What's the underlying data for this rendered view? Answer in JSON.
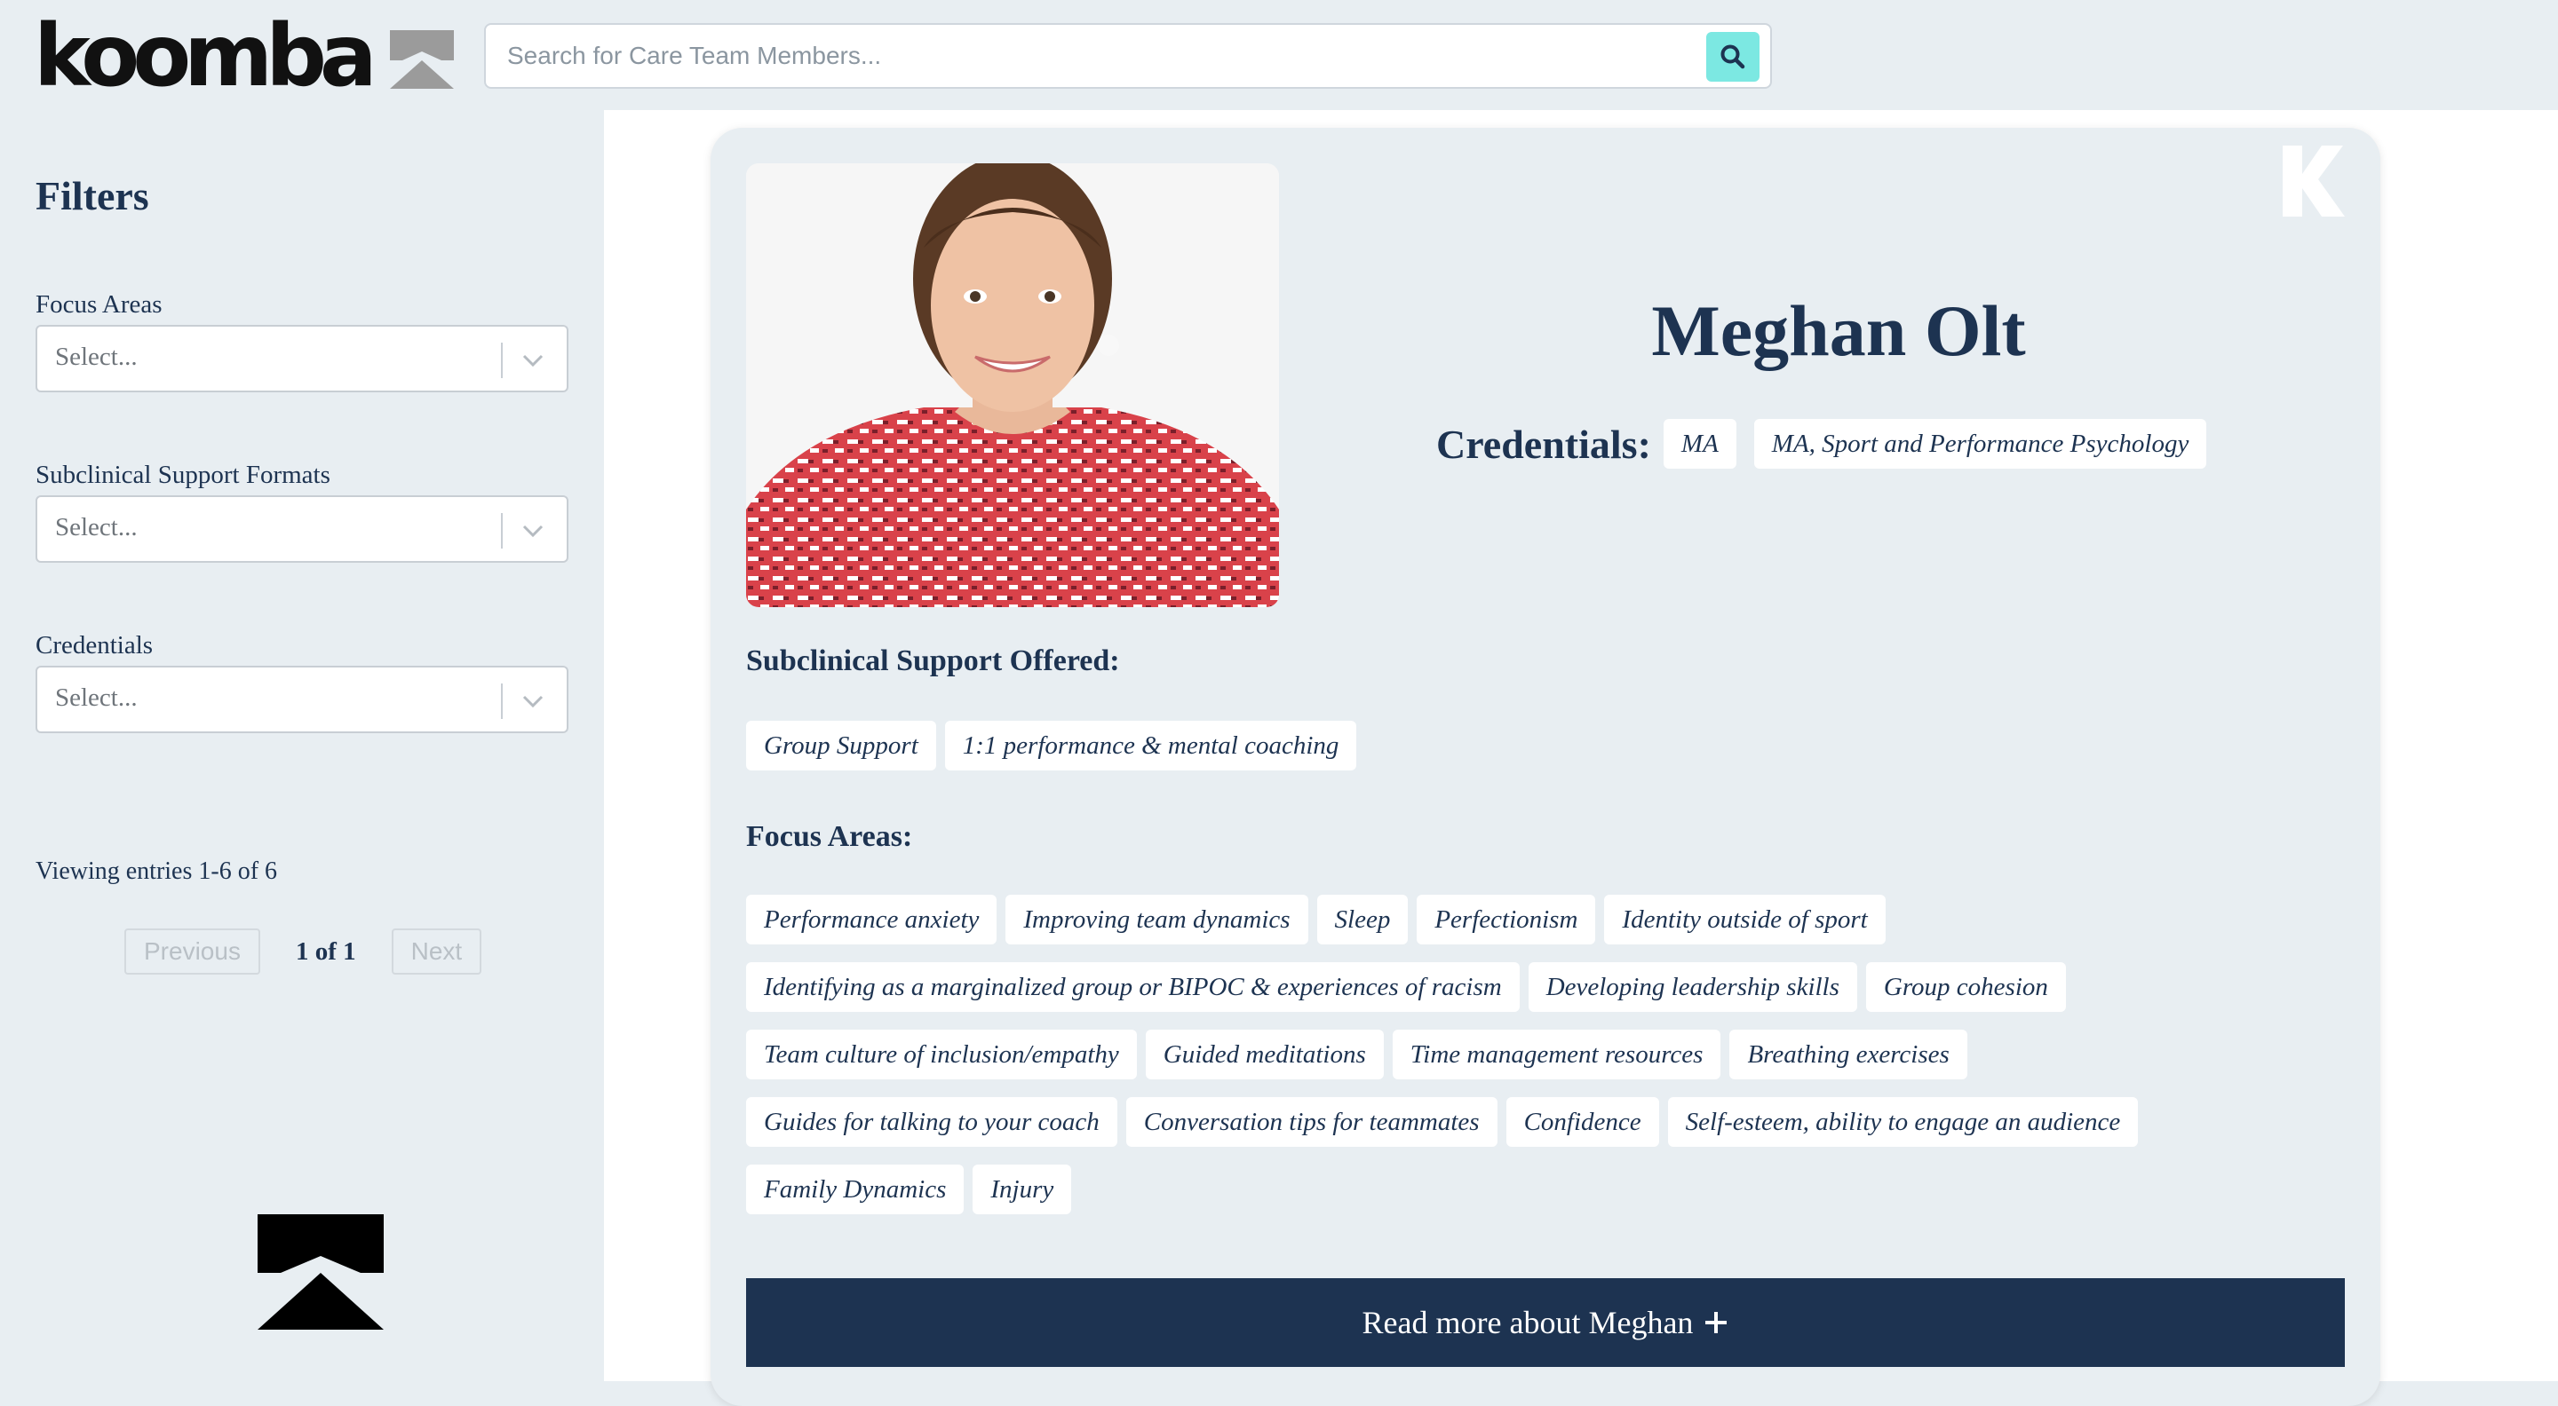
{
  "header": {
    "logo_text": "koomba",
    "search_placeholder": "Search for Care Team Members...",
    "icons": {
      "search": "search-icon",
      "logo_mark": "koomba-mark-icon"
    }
  },
  "sidebar": {
    "title": "Filters",
    "filters": [
      {
        "label": "Focus Areas",
        "placeholder": "Select..."
      },
      {
        "label": "Subclinical Support Formats",
        "placeholder": "Select..."
      },
      {
        "label": "Credentials",
        "placeholder": "Select..."
      }
    ],
    "entries_text": "Viewing entries 1-6 of 6",
    "pager": {
      "previous": "Previous",
      "info": "1 of 1",
      "next": "Next"
    }
  },
  "profile": {
    "name": "Meghan Olt",
    "credentials_label": "Credentials:",
    "credentials": [
      "MA",
      "MA, Sport and Performance Psychology"
    ],
    "support_title": "Subclinical Support Offered:",
    "support": [
      "Group Support",
      "1:1 performance & mental coaching"
    ],
    "focus_title": "Focus Areas:",
    "focus_rows": [
      [
        "Performance anxiety",
        "Improving team dynamics",
        "Sleep",
        "Perfectionism",
        "Identity outside of sport"
      ],
      [
        "Identifying as a marginalized group or BIPOC & experiences of racism",
        "Developing leadership skills",
        "Group cohesion"
      ],
      [
        "Team culture of inclusion/empathy",
        "Guided meditations",
        "Time management resources",
        "Breathing exercises"
      ],
      [
        "Guides for talking to your coach",
        "Conversation tips for teammates",
        "Confidence",
        "Self-esteem, ability to engage an audience"
      ],
      [
        "Family Dynamics",
        "Injury"
      ]
    ],
    "read_more": "Read more about Meghan"
  },
  "colors": {
    "navy": "#1d3351",
    "accent": "#7ce8e2",
    "background": "#e8eef2"
  }
}
